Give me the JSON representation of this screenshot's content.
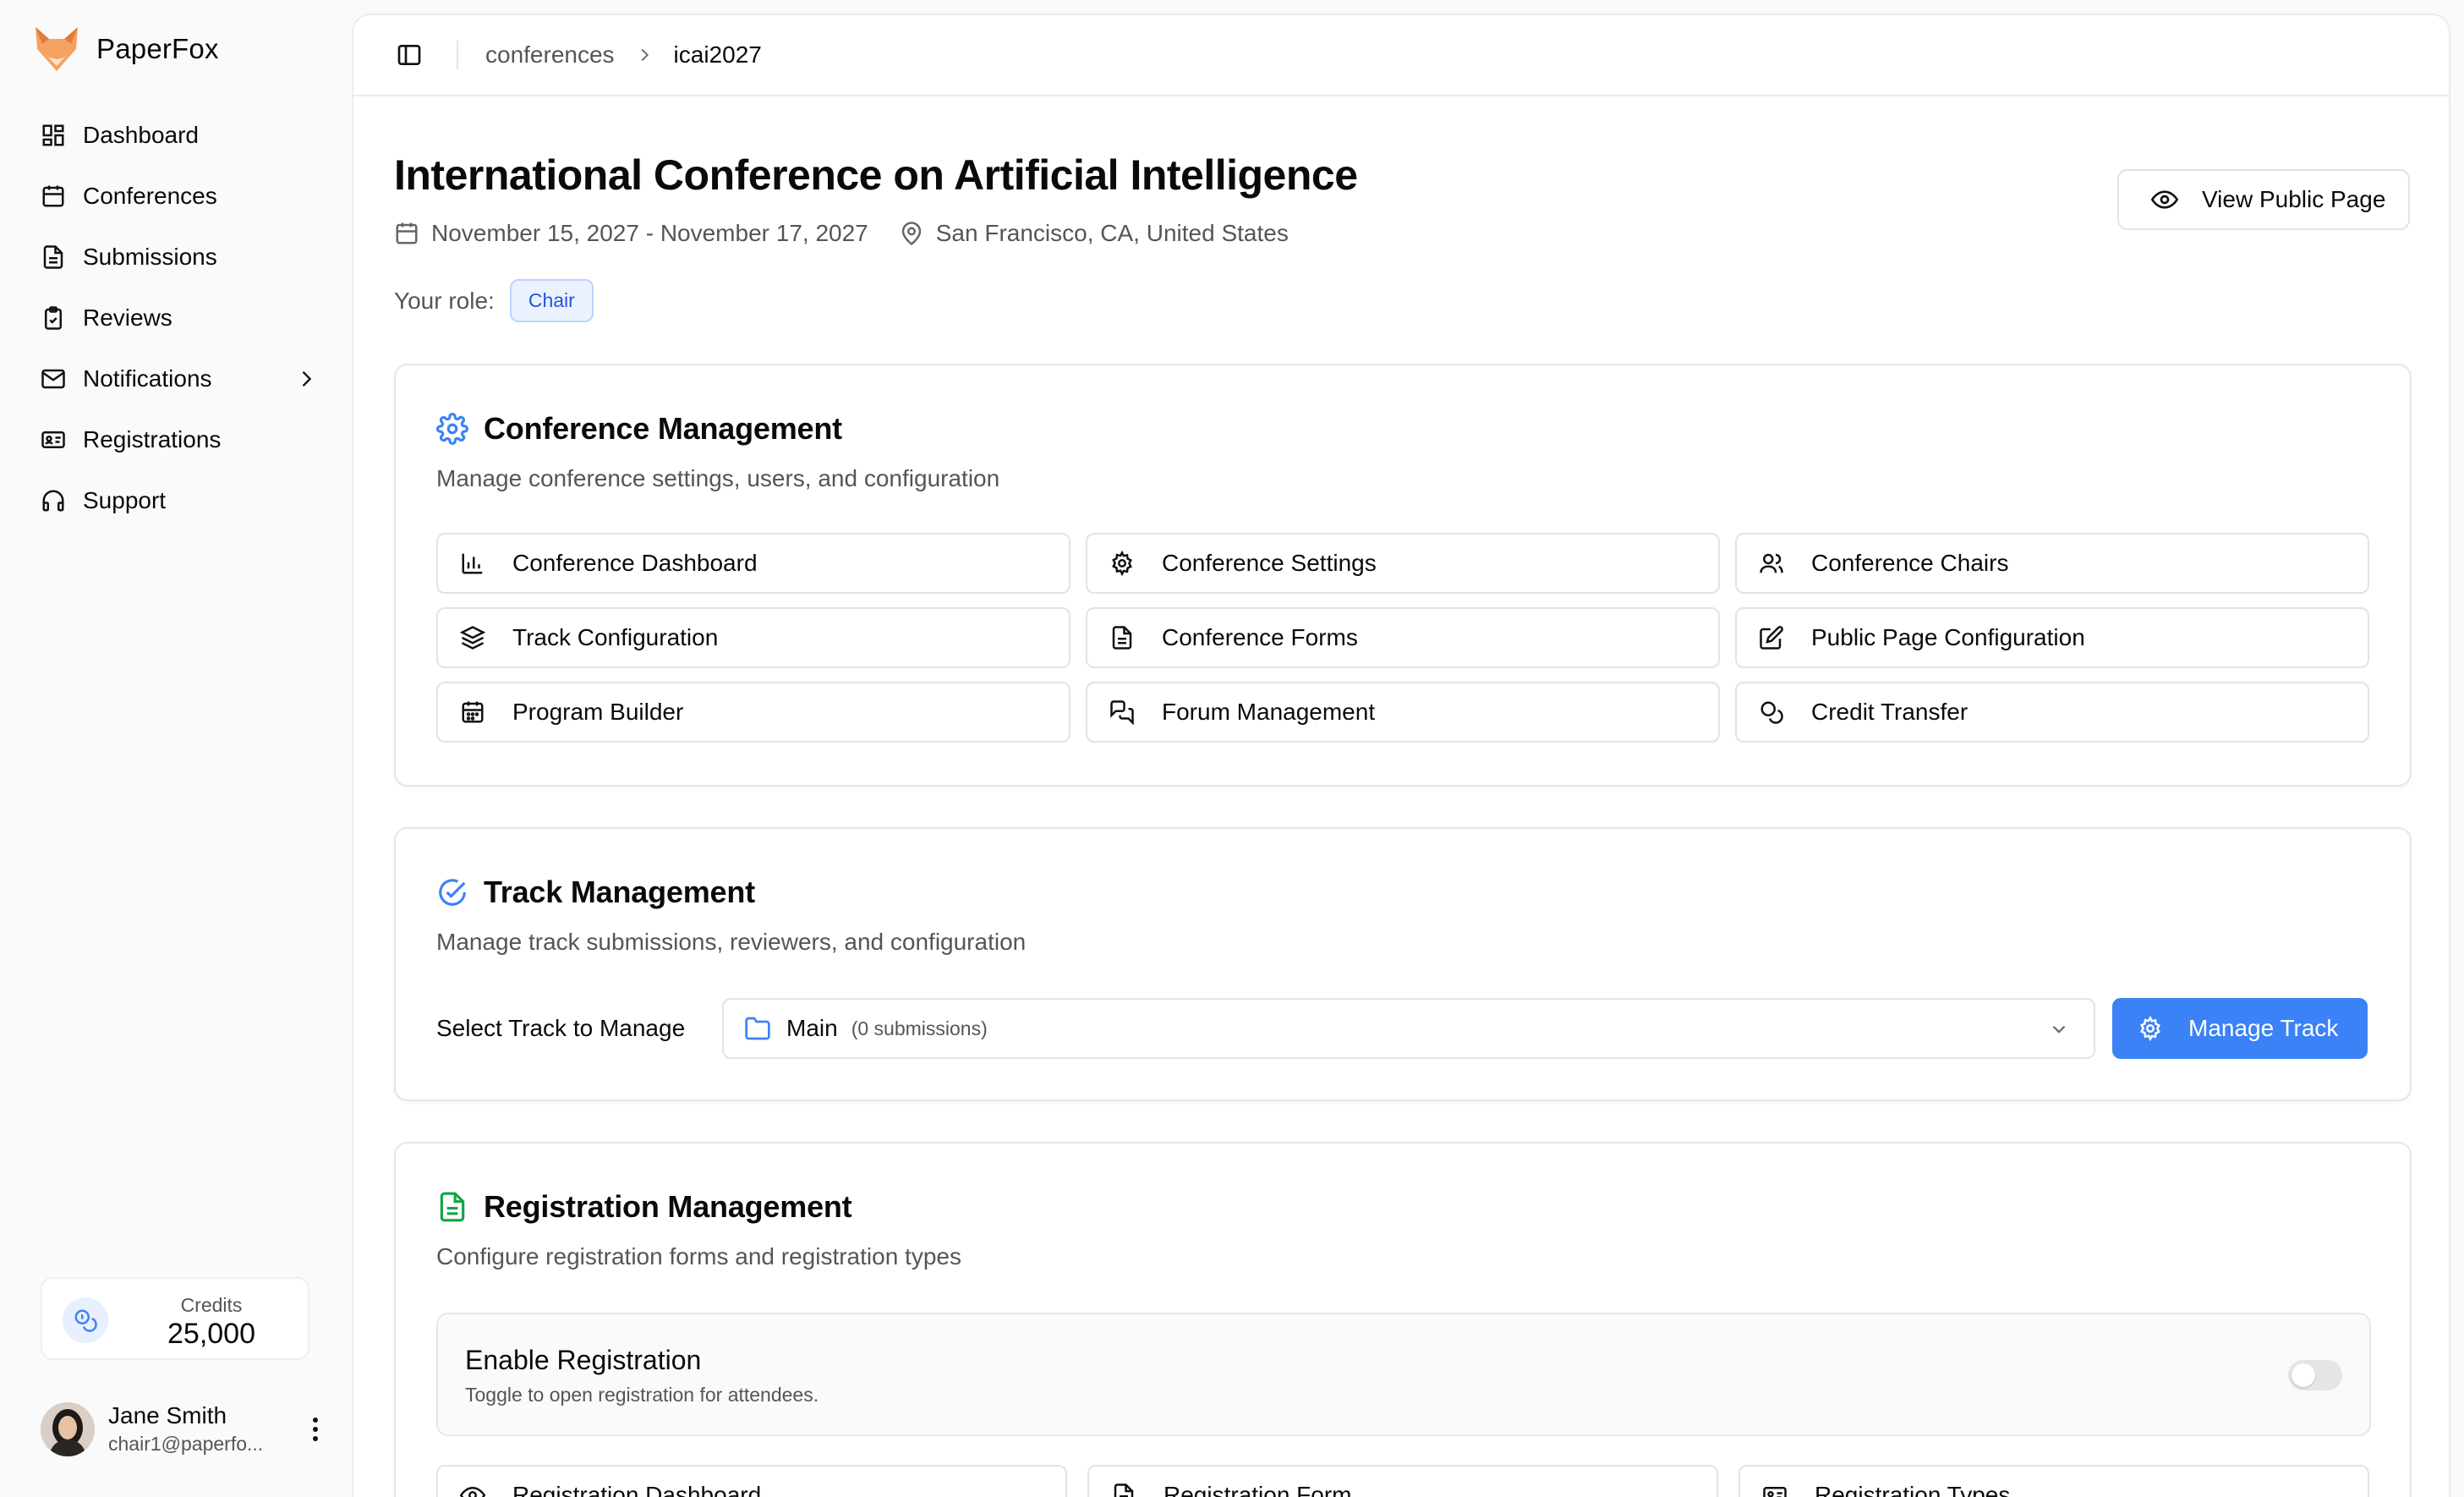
{
  "app": {
    "name": "PaperFox"
  },
  "sidebar": {
    "items": [
      {
        "label": "Dashboard",
        "icon": "dashboard-icon"
      },
      {
        "label": "Conferences",
        "icon": "calendar-icon"
      },
      {
        "label": "Submissions",
        "icon": "file-icon"
      },
      {
        "label": "Reviews",
        "icon": "clipboard-check-icon"
      },
      {
        "label": "Notifications",
        "icon": "mail-icon"
      },
      {
        "label": "Registrations",
        "icon": "id-card-icon"
      },
      {
        "label": "Support",
        "icon": "headphones-icon"
      }
    ],
    "credits": {
      "label": "Credits",
      "value": "25,000"
    },
    "user": {
      "name": "Jane Smith",
      "email": "chair1@paperfo..."
    }
  },
  "breadcrumb": {
    "parent": "conferences",
    "current": "icai2027"
  },
  "conference": {
    "title": "International Conference on Artificial Intelligence",
    "dates": "November 15, 2027 - November 17, 2027",
    "location": "San Francisco, CA, United States",
    "role_label": "Your role:",
    "role": "Chair",
    "view_public_label": "View Public Page"
  },
  "conference_management": {
    "title": "Conference Management",
    "description": "Manage conference settings, users, and configuration",
    "tiles": [
      {
        "label": "Conference Dashboard",
        "icon": "bar-chart-icon"
      },
      {
        "label": "Conference Settings",
        "icon": "gear-icon"
      },
      {
        "label": "Conference Chairs",
        "icon": "users-icon"
      },
      {
        "label": "Track Configuration",
        "icon": "layers-icon"
      },
      {
        "label": "Conference Forms",
        "icon": "file-text-icon"
      },
      {
        "label": "Public Page Configuration",
        "icon": "edit-icon"
      },
      {
        "label": "Program Builder",
        "icon": "calendar-grid-icon"
      },
      {
        "label": "Forum Management",
        "icon": "chat-icon"
      },
      {
        "label": "Credit Transfer",
        "icon": "coins-icon"
      }
    ]
  },
  "track_management": {
    "title": "Track Management",
    "description": "Manage track submissions, reviewers, and configuration",
    "select_label": "Select Track to Manage",
    "selected_track": "Main",
    "selected_count": "(0 submissions)",
    "button_label": "Manage Track"
  },
  "registration_management": {
    "title": "Registration Management",
    "description": "Configure registration forms and registration types",
    "enable_title": "Enable Registration",
    "enable_sub": "Toggle to open registration for attendees.",
    "enabled": false,
    "tiles": [
      {
        "label": "Registration Dashboard",
        "icon": "eye-icon"
      },
      {
        "label": "Registration Form",
        "icon": "file-text-icon"
      },
      {
        "label": "Registration Types",
        "icon": "id-card-icon"
      }
    ]
  },
  "colors": {
    "accent": "#3b82f6",
    "badge_text": "#2356d8",
    "registration_icon": "#16a34a"
  }
}
